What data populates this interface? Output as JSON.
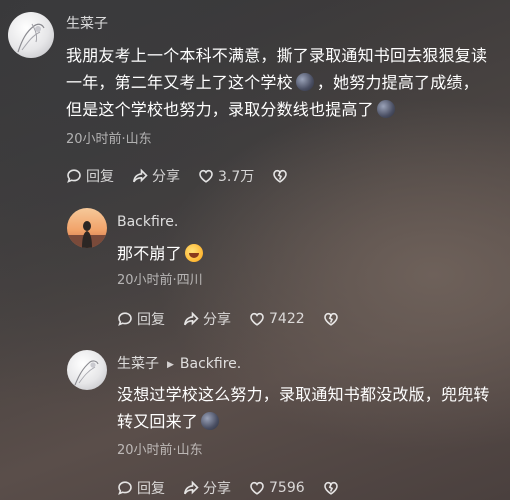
{
  "comments": [
    {
      "user": "生菜子",
      "lines": [
        "我朋友考上一个本科不满意，撕了录取通知书回去狠狠复读",
        "一年，第二年又考上了这个学校",
        "，她努力提高了成绩，",
        "但是这个学校也努力，录取分数线也提高了"
      ],
      "meta": "20小时前·山东",
      "reply_label": "回复",
      "share_label": "分享",
      "likes": "3.7万"
    },
    {
      "user": "Backfire.",
      "lines": [
        "那不崩了"
      ],
      "meta": "20小时前·四川",
      "reply_label": "回复",
      "share_label": "分享",
      "likes": "7422"
    },
    {
      "user": "生菜子",
      "reply_to": "Backfire.",
      "lines": [
        "没想过学校这么努力，录取通知书都没改版，兜兜转",
        "转又回来了"
      ],
      "meta": "20小时前·山东",
      "reply_label": "回复",
      "share_label": "分享",
      "likes": "7596"
    }
  ],
  "icons": {
    "reply": "comment-bubble-icon",
    "share": "share-arrow-icon",
    "like": "heart-icon",
    "dislike": "broken-heart-icon",
    "emoji_sleep": "dark-face-emoji",
    "emoji_laugh": "rofl-emoji"
  }
}
